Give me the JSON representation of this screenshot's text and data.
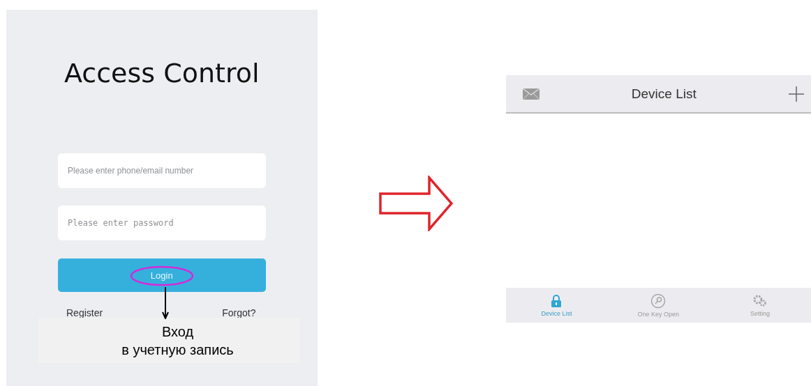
{
  "login_screen": {
    "title": "Access Control",
    "fields": [
      {
        "kind": "text",
        "placeholder": "Please enter phone/email number"
      },
      {
        "kind": "password",
        "placeholder": "Please enter password"
      }
    ],
    "login_button": "Login",
    "links": [
      "Register",
      "Forgot?"
    ]
  },
  "annotation": {
    "caption": "Вход\nв учетную запись"
  },
  "device_list_screen": {
    "title": "Device List",
    "tabs": [
      {
        "label": "Device List",
        "selected": true
      },
      {
        "label": "One Key Open",
        "selected": false
      },
      {
        "label": "Setting",
        "selected": false
      }
    ]
  }
}
